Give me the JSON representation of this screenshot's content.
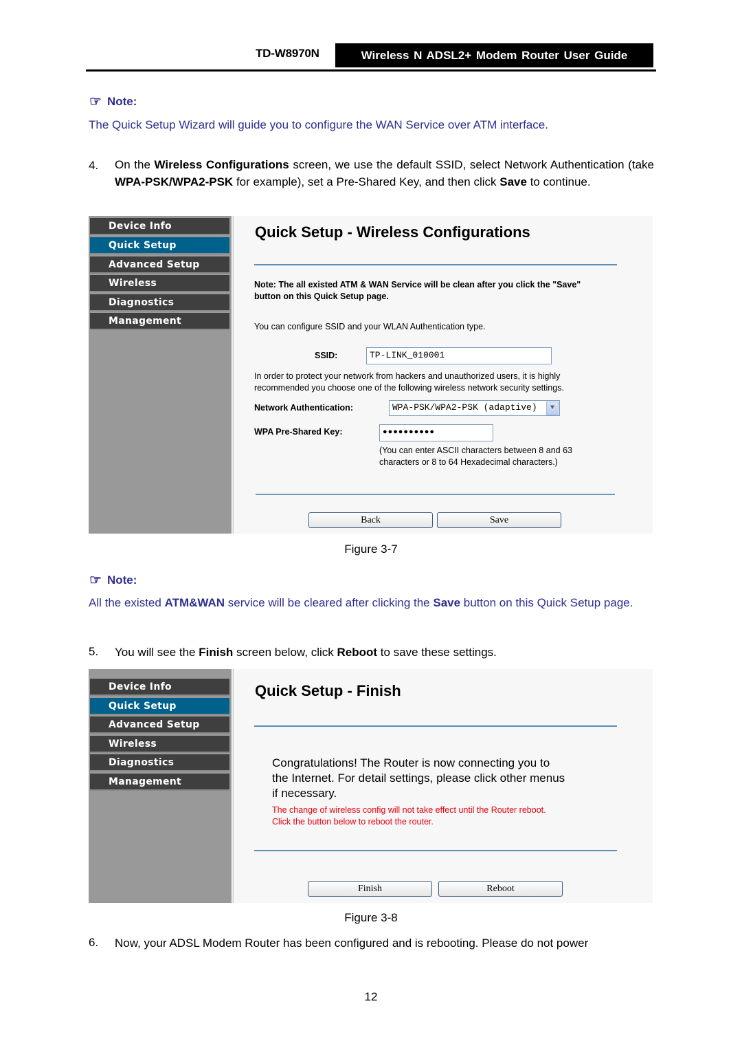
{
  "header": {
    "model": "TD-W8970N",
    "title": "Wireless N ADSL2+ Modem Router User Guide"
  },
  "note1": {
    "icon": "pointing-hand-icon",
    "label": "Note:",
    "text": "The Quick Setup Wizard will guide you to configure the WAN Service over ATM interface."
  },
  "step4": {
    "number": "4.",
    "p1": "On the ",
    "b1": "Wireless Configurations",
    "p2": " screen, we use the default SSID, select Network Authentication (take ",
    "b2": "WPA-PSK/WPA2-PSK",
    "p3": " for example), set a Pre-Shared Key, and then click ",
    "b3": "Save",
    "p4": " to continue."
  },
  "nav": {
    "items": [
      {
        "label": "Device Info"
      },
      {
        "label": "Quick Setup"
      },
      {
        "label": "Advanced Setup"
      },
      {
        "label": "Wireless"
      },
      {
        "label": "Diagnostics"
      },
      {
        "label": "Management"
      }
    ],
    "active_index": 1
  },
  "figure7": {
    "title": "Quick Setup - Wireless Configurations",
    "note_line1": "Note: The all existed ATM & WAN Service will be clean after you click the \"Save\"",
    "note_line2": "button on this Quick Setup page.",
    "intro": "You can configure SSID and your WLAN Authentication type.",
    "ssid_label": "SSID:",
    "ssid_value": "TP-LINK_010001",
    "protect_line1": "In order to protect your network from hackers and unauthorized users, it is highly",
    "protect_line2": "recommended you choose one of the following wireless network security settings.",
    "auth_label": "Network Authentication:",
    "auth_value": "WPA-PSK/WPA2-PSK (adaptive)",
    "key_label": "WPA Pre-Shared Key:",
    "key_value": "●●●●●●●●●●",
    "key_hint1": "(You can enter ASCII characters between 8 and 63",
    "key_hint2": "characters or 8 to 64 Hexadecimal characters.)",
    "back_label": "Back",
    "save_label": "Save",
    "caption": "Figure 3-7"
  },
  "note2": {
    "icon": "pointing-hand-icon",
    "label": "Note:",
    "t1": "All the existed ",
    "b1": "ATM&WAN",
    "t2": " service will be cleared after clicking the ",
    "b2": "Save",
    "t3": " button on this Quick Setup page."
  },
  "step5": {
    "number": "5.",
    "t1": "You will see the ",
    "b1": "Finish",
    "t2": " screen below, click ",
    "b2": "Reboot",
    "t3": " to save these settings."
  },
  "figure8": {
    "title": "Quick Setup - Finish",
    "congrats_line1": "Congratulations! The Router is now connecting you to",
    "congrats_line2": "the Internet. For detail settings, please click other menus",
    "congrats_line3": "if necessary.",
    "warn_line1": "The change of wireless config will not take effect until the Router reboot.",
    "warn_line2": "Click the button below to reboot the router.",
    "finish_label": "Finish",
    "reboot_label": "Reboot",
    "caption": "Figure 3-8"
  },
  "step6": {
    "number": "6.",
    "text": "Now, your ADSL Modem Router has been configured and is rebooting. Please do not power"
  },
  "page_number": "12",
  "colors": {
    "note_blue": "#2e2e8f",
    "nav_active": "#00628c",
    "nav_bg": "#3f3f3f",
    "warn_red": "#e8000d"
  }
}
